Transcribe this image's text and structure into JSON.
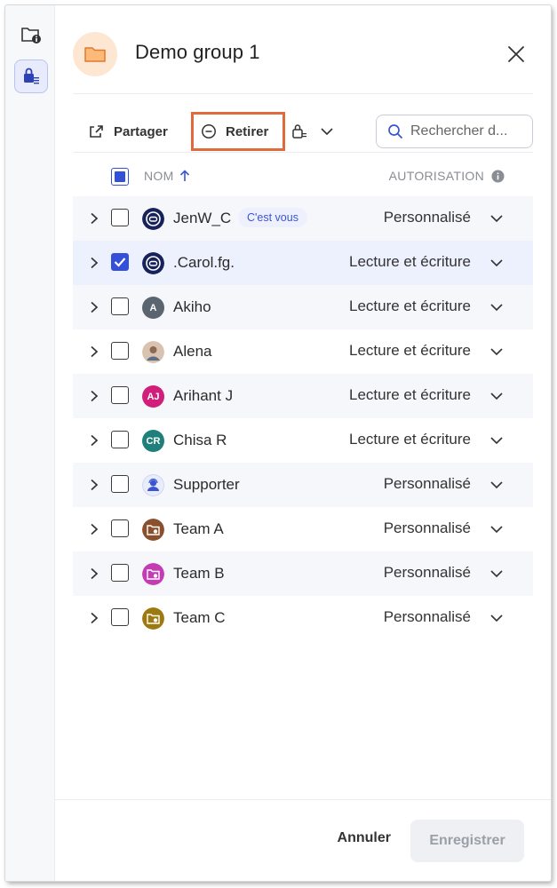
{
  "header": {
    "title": "Demo group 1"
  },
  "toolbar": {
    "share_label": "Partager",
    "remove_label": "Retirer",
    "search_placeholder": "Rechercher d..."
  },
  "columns": {
    "name": "NOM",
    "permission": "AUTORISATION"
  },
  "rows": [
    {
      "name": "JenW_C",
      "badge": "C'est vous",
      "permission": "Personnalisé",
      "checked": false,
      "avatar": "icon-user",
      "avatar_color": "#17225a"
    },
    {
      "name": ".Carol.fg.",
      "permission": "Lecture et écriture",
      "checked": true,
      "avatar": "icon-user",
      "avatar_color": "#17225a"
    },
    {
      "name": "Akiho",
      "permission": "Lecture et écriture",
      "checked": false,
      "avatar_initials": "A",
      "avatar_color": "#5b6570"
    },
    {
      "name": "Alena",
      "permission": "Lecture et écriture",
      "checked": false,
      "avatar": "photo",
      "avatar_color": "#d9c3b0"
    },
    {
      "name": "Arihant J",
      "permission": "Lecture et écriture",
      "checked": false,
      "avatar_initials": "AJ",
      "avatar_color": "#d01e7a"
    },
    {
      "name": "Chisa R",
      "permission": "Lecture et écriture",
      "checked": false,
      "avatar_initials": "CR",
      "avatar_color": "#1f7f7a"
    },
    {
      "name": "Supporter",
      "permission": "Personnalisé",
      "checked": false,
      "avatar": "icon-support",
      "avatar_color": "#e8ecfb"
    },
    {
      "name": "Team A",
      "permission": "Personnalisé",
      "checked": false,
      "avatar": "icon-team",
      "avatar_color": "#8a4f2c"
    },
    {
      "name": "Team B",
      "permission": "Personnalisé",
      "checked": false,
      "avatar": "icon-team",
      "avatar_color": "#c43bb4"
    },
    {
      "name": "Team C",
      "permission": "Personnalisé",
      "checked": false,
      "avatar": "icon-team",
      "avatar_color": "#9c7a10"
    }
  ],
  "footer": {
    "cancel_label": "Annuler",
    "save_label": "Enregistrer"
  }
}
